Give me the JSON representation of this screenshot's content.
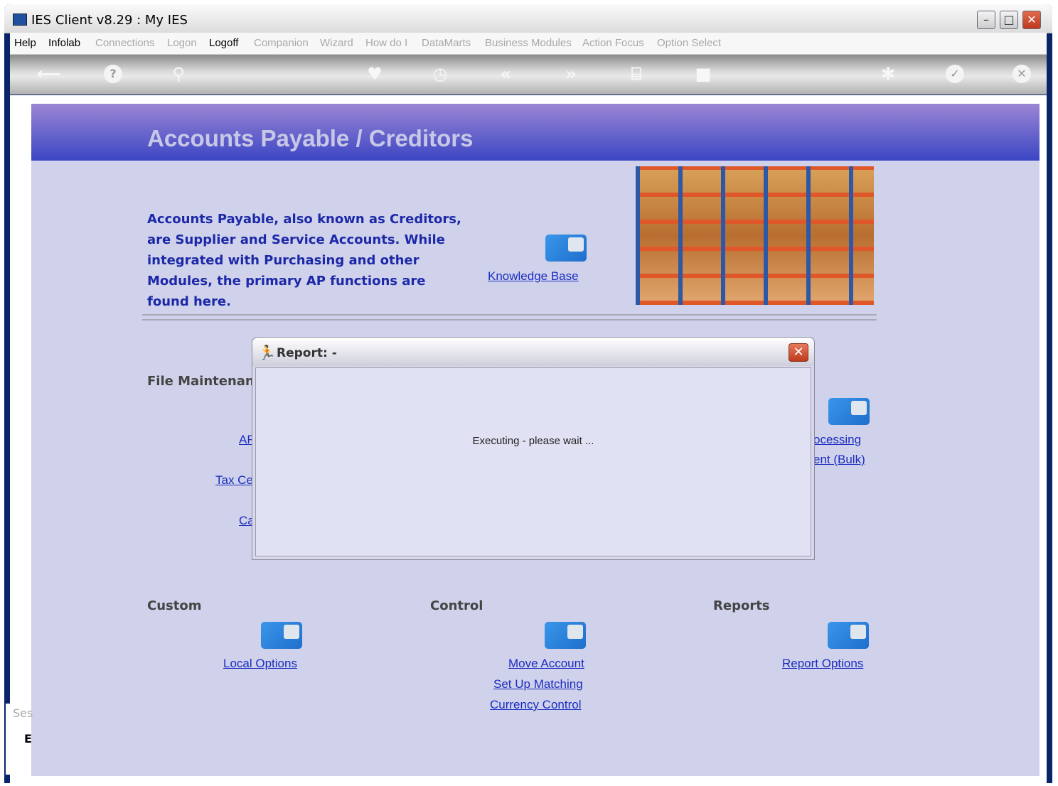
{
  "window": {
    "title": "IES Client v8.29 : My IES",
    "min": "–",
    "max": "□",
    "close": "✕"
  },
  "menu": {
    "items": [
      {
        "label": "Help",
        "enabled": true
      },
      {
        "label": "Infolab",
        "enabled": true
      },
      {
        "label": "Connections",
        "enabled": false
      },
      {
        "label": "Logon",
        "enabled": false
      },
      {
        "label": "Logoff",
        "enabled": true
      },
      {
        "label": "Companion",
        "enabled": false
      },
      {
        "label": "Wizard",
        "enabled": false
      },
      {
        "label": "How do I",
        "enabled": false
      },
      {
        "label": "DataMarts",
        "enabled": false
      },
      {
        "label": "Business Modules",
        "enabled": false
      },
      {
        "label": "Action Focus",
        "enabled": false
      },
      {
        "label": "Option Select",
        "enabled": false
      }
    ]
  },
  "toolbar": {
    "back": "⟵",
    "help": "?",
    "search": "⚲",
    "heart": "♥",
    "clock": "◷",
    "prev": "«",
    "next": "»",
    "doc": "⌸",
    "square": "■",
    "gear": "✱",
    "check": "✓",
    "close": "✕"
  },
  "page": {
    "title": "Accounts Payable / Creditors",
    "intro": "Accounts Payable, also known as Creditors, are Supplier and Service Accounts. While integrated with Purchasing and other Modules, the primary AP functions are found here.",
    "knowledge_base": "Knowledge Base",
    "file_maintenance": "File Maintenanc",
    "fm_links": [
      "AF",
      "Tax Ce",
      "Ca"
    ],
    "right_links": [
      "ocessing",
      "ent (Bulk)"
    ],
    "custom": "Custom",
    "control": "Control",
    "reports": "Reports",
    "local_options": "Local Options",
    "move_account": "Move Account",
    "set_up_matching": "Set Up Matching",
    "currency_control": "Currency Control",
    "report_options": "Report Options",
    "left_strip_1": "Ses",
    "left_strip_2": "E"
  },
  "dialog": {
    "title": "Report: -",
    "close": "✕",
    "message": "Executing - please wait ..."
  }
}
